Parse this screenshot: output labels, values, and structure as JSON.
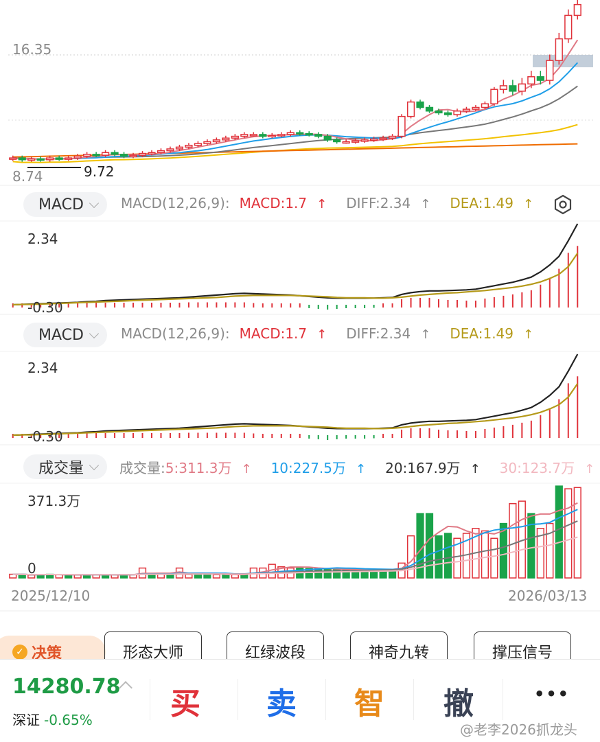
{
  "price_chart": {
    "high_label": "16.35",
    "low_label": "8.74",
    "marker_label": "9.72"
  },
  "macd_panels": [
    {
      "selector_label": "MACD",
      "params": "MACD(12,26,9):",
      "macd": "MACD:1.7",
      "diff": "DIFF:2.34",
      "dea": "DEA:1.49",
      "arrow": "↑",
      "top_value": "2.34",
      "bottom_value": "-0.30"
    },
    {
      "selector_label": "MACD",
      "params": "MACD(12,26,9):",
      "macd": "MACD:1.7",
      "diff": "DIFF:2.34",
      "dea": "DEA:1.49",
      "arrow": "↑",
      "top_value": "2.34",
      "bottom_value": "-0.30"
    }
  ],
  "volume_panel": {
    "selector_label": "成交量",
    "params": "成交量:",
    "ma5": "5:311.3万",
    "ma10": "10:227.5万",
    "ma20": "20:167.9万",
    "ma30": "30:123.7万",
    "arrow": "↑",
    "top_value": "371.3万",
    "zero_value": "0"
  },
  "date_axis": {
    "start": "2025/12/10",
    "end": "2026/03/13"
  },
  "tool_tabs": {
    "decision": "决策",
    "items": [
      "形态大师",
      "红绿波段",
      "神奇九转",
      "撑压信号"
    ]
  },
  "bottom_bar": {
    "index_value": "14280.78",
    "index_name": "深证",
    "index_change": "-0.65%",
    "buy": "买",
    "sell": "卖",
    "smart": "智",
    "cancel": "撤",
    "more": "•••"
  },
  "watermark": "@老李2026抓龙头",
  "colors": {
    "up": "#e0323a",
    "down": "#1aa34a",
    "diff_line": "#222222",
    "dea_line": "#b59a1a",
    "ma5": "#e07a86",
    "ma10": "#1f9ee8",
    "ma20": "#777777",
    "ma30": "#f2b8c0",
    "ma60": "#f2c200",
    "ma120": "#ef6c00"
  },
  "chart_data": [
    {
      "type": "candlestick",
      "title": "",
      "series_values": [
        9.3,
        9.2,
        9.25,
        9.2,
        9.3,
        9.25,
        9.3,
        9.4,
        9.5,
        9.45,
        9.6,
        9.5,
        9.4,
        9.45,
        9.55,
        9.6,
        9.7,
        9.8,
        9.9,
        10.0,
        10.1,
        10.2,
        10.3,
        10.4,
        10.5,
        10.6,
        10.6,
        10.5,
        10.55,
        10.6,
        10.7,
        10.65,
        10.6,
        10.5,
        10.3,
        10.2,
        10.2,
        10.25,
        10.3,
        10.35,
        10.4,
        10.5,
        11.6,
        12.4,
        12.1,
        11.9,
        11.8,
        11.7,
        11.9,
        12.0,
        12.1,
        12.3,
        13.1,
        13.3,
        13.0,
        13.4,
        13.8,
        13.6,
        14.7,
        15.9,
        17.2,
        17.8
      ],
      "high_label": "16.35",
      "low_label": "8.74",
      "marked_low": "9.72"
    },
    {
      "type": "bar",
      "title": "MACD(12,26,9)",
      "diff": [
        0.0,
        0.01,
        0.02,
        0.03,
        0.04,
        0.05,
        0.06,
        0.07,
        0.09,
        0.1,
        0.12,
        0.13,
        0.14,
        0.15,
        0.16,
        0.17,
        0.18,
        0.19,
        0.2,
        0.22,
        0.24,
        0.26,
        0.28,
        0.3,
        0.32,
        0.33,
        0.32,
        0.31,
        0.3,
        0.29,
        0.28,
        0.26,
        0.24,
        0.22,
        0.2,
        0.19,
        0.19,
        0.19,
        0.19,
        0.19,
        0.2,
        0.21,
        0.3,
        0.35,
        0.38,
        0.4,
        0.4,
        0.41,
        0.42,
        0.43,
        0.45,
        0.5,
        0.55,
        0.6,
        0.65,
        0.72,
        0.8,
        0.95,
        1.15,
        1.4,
        1.85,
        2.34
      ],
      "dea": [
        0.0,
        0.01,
        0.01,
        0.02,
        0.03,
        0.04,
        0.05,
        0.06,
        0.07,
        0.08,
        0.09,
        0.1,
        0.11,
        0.12,
        0.13,
        0.14,
        0.15,
        0.16,
        0.17,
        0.18,
        0.19,
        0.2,
        0.21,
        0.23,
        0.25,
        0.26,
        0.27,
        0.27,
        0.27,
        0.27,
        0.27,
        0.26,
        0.25,
        0.24,
        0.23,
        0.21,
        0.2,
        0.2,
        0.2,
        0.19,
        0.19,
        0.2,
        0.22,
        0.25,
        0.28,
        0.3,
        0.32,
        0.34,
        0.35,
        0.37,
        0.39,
        0.41,
        0.44,
        0.47,
        0.5,
        0.54,
        0.59,
        0.66,
        0.76,
        0.88,
        1.1,
        1.49
      ],
      "macd": [
        0.0,
        0.02,
        0.02,
        0.03,
        0.03,
        0.04,
        0.04,
        0.05,
        0.05,
        0.06,
        0.06,
        0.06,
        0.06,
        0.06,
        0.06,
        0.06,
        0.06,
        0.06,
        0.06,
        0.07,
        0.07,
        0.07,
        0.07,
        0.07,
        0.07,
        0.07,
        0.05,
        0.04,
        0.03,
        0.02,
        0.01,
        0.0,
        -0.02,
        -0.04,
        -0.06,
        -0.04,
        -0.02,
        -0.02,
        -0.02,
        -0.01,
        0.01,
        0.02,
        0.16,
        0.2,
        0.2,
        0.2,
        0.16,
        0.14,
        0.14,
        0.12,
        0.12,
        0.18,
        0.22,
        0.26,
        0.3,
        0.36,
        0.42,
        0.58,
        0.78,
        1.04,
        1.5,
        1.7
      ],
      "ylim": [
        -0.3,
        2.34
      ]
    },
    {
      "type": "bar",
      "title": "成交量",
      "unit": "万",
      "values": [
        15,
        14,
        12,
        13,
        15,
        14,
        13,
        12,
        12,
        14,
        13,
        12,
        14,
        13,
        40,
        14,
        15,
        13,
        40,
        14,
        15,
        14,
        13,
        14,
        13,
        14,
        40,
        40,
        55,
        45,
        40,
        40,
        38,
        38,
        35,
        33,
        33,
        35,
        34,
        33,
        33,
        34,
        60,
        170,
        260,
        260,
        170,
        180,
        160,
        180,
        200,
        190,
        160,
        220,
        300,
        310,
        260,
        200,
        220,
        371,
        360,
        365
      ],
      "up": [
        true,
        false,
        true,
        false,
        false,
        true,
        false,
        true,
        false,
        true,
        false,
        true,
        false,
        true,
        true,
        false,
        true,
        false,
        true,
        true,
        false,
        false,
        true,
        false,
        true,
        false,
        true,
        true,
        true,
        true,
        true,
        false,
        false,
        false,
        false,
        false,
        false,
        false,
        false,
        false,
        false,
        false,
        true,
        true,
        false,
        false,
        false,
        false,
        true,
        true,
        true,
        true,
        true,
        false,
        true,
        true,
        false,
        true,
        true,
        false,
        true,
        true
      ],
      "ylim": [
        0,
        371.3
      ]
    }
  ]
}
